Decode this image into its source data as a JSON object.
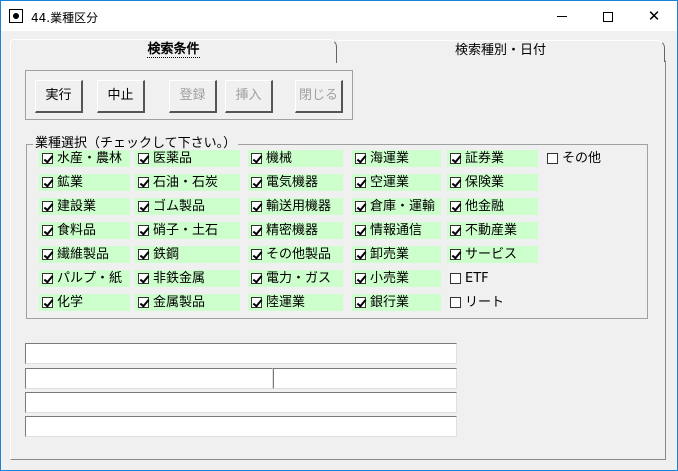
{
  "window": {
    "title": "44.業種区分"
  },
  "tabs": [
    {
      "label": "検索条件"
    },
    {
      "label": "検索種別・日付"
    }
  ],
  "toolbar": {
    "run_label": "実行",
    "stop_label": "中止",
    "register_label": "登録",
    "insert_label": "挿入",
    "close_label": "閉じる"
  },
  "industry": {
    "group_label": "業種選択（チェックして下さい。）",
    "items": [
      {
        "label": "水産・農林",
        "checked": true
      },
      {
        "label": "鉱業",
        "checked": true
      },
      {
        "label": "建設業",
        "checked": true
      },
      {
        "label": "食料品",
        "checked": true
      },
      {
        "label": "繊維製品",
        "checked": true
      },
      {
        "label": "パルプ・紙",
        "checked": true
      },
      {
        "label": "化学",
        "checked": true
      },
      {
        "label": "医薬品",
        "checked": true
      },
      {
        "label": "石油・石炭",
        "checked": true
      },
      {
        "label": "ゴム製品",
        "checked": true
      },
      {
        "label": "硝子・土石",
        "checked": true
      },
      {
        "label": "鉄鋼",
        "checked": true
      },
      {
        "label": "非鉄金属",
        "checked": true
      },
      {
        "label": "金属製品",
        "checked": true
      },
      {
        "label": "機械",
        "checked": true
      },
      {
        "label": "電気機器",
        "checked": true
      },
      {
        "label": "輸送用機器",
        "checked": true
      },
      {
        "label": "精密機器",
        "checked": true
      },
      {
        "label": "その他製品",
        "checked": true
      },
      {
        "label": "電力・ガス",
        "checked": true
      },
      {
        "label": "陸運業",
        "checked": true
      },
      {
        "label": "海運業",
        "checked": true
      },
      {
        "label": "空運業",
        "checked": true
      },
      {
        "label": "倉庫・運輸",
        "checked": true
      },
      {
        "label": "情報通信",
        "checked": true
      },
      {
        "label": "卸売業",
        "checked": true
      },
      {
        "label": "小売業",
        "checked": true
      },
      {
        "label": "銀行業",
        "checked": true
      },
      {
        "label": "証券業",
        "checked": true
      },
      {
        "label": "保険業",
        "checked": true
      },
      {
        "label": "他金融",
        "checked": true
      },
      {
        "label": "不動産業",
        "checked": true
      },
      {
        "label": "サービス",
        "checked": true
      },
      {
        "label": "ETF",
        "checked": false
      },
      {
        "label": "リート",
        "checked": false
      },
      {
        "label": "その他",
        "checked": false
      }
    ]
  },
  "fields": {
    "field1": "",
    "field2a": "",
    "field2b": "",
    "field3": "",
    "field4": ""
  }
}
